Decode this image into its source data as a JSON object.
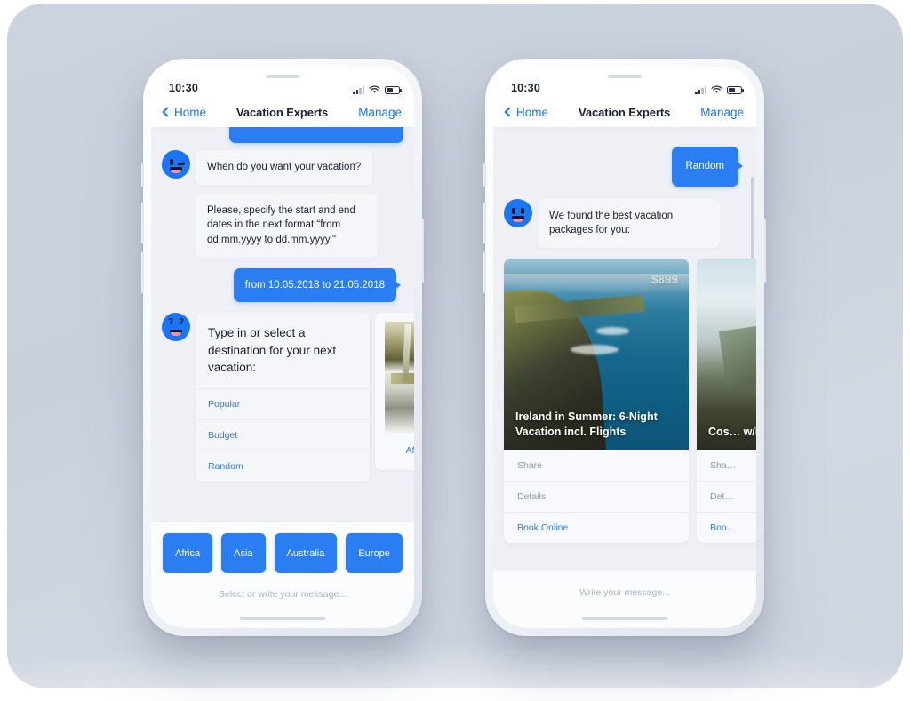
{
  "background": {
    "color": "#ccd3de"
  },
  "theme": {
    "accent": "#2a7ef2",
    "link": "#1775f0",
    "bubble_in_bg": "#f4f6fa",
    "text": "#1b2136",
    "muted": "#8e99ad"
  },
  "phones": [
    {
      "id": "left",
      "status_bar": {
        "time": "10:30",
        "signal_icon": "signal-bars-icon",
        "wifi_icon": "wifi-icon",
        "battery_icon": "battery-icon"
      },
      "nav": {
        "back_label": "Home",
        "back_icon": "chevron-left-icon",
        "title": "Vacation Experts",
        "action_label": "Manage"
      },
      "messages": [
        {
          "type": "outgoing-cutoff",
          "text": ""
        },
        {
          "type": "incoming",
          "avatar": "bot-wink-face",
          "text": "When do you want your vacation?"
        },
        {
          "type": "incoming",
          "avatar": "none",
          "text": "Please, specify the start and end dates in the next format “from dd.mm.yyyy to dd.mm.yyyy.\""
        },
        {
          "type": "outgoing",
          "text": "from 10.05.2018 to 21.05.2018"
        }
      ],
      "selector": {
        "avatar": "bot-question-face",
        "prompt": "Type in or select a destination for your next vacation:",
        "options": [
          "Popular",
          "Budget",
          "Random"
        ],
        "side_card_label": "Africa"
      },
      "quick_replies": [
        "Africa",
        "Asia",
        "Australia",
        "Europe"
      ],
      "composer": {
        "placeholder": "Select or write your message..."
      }
    },
    {
      "id": "right",
      "status_bar": {
        "time": "10:30",
        "signal_icon": "signal-bars-icon",
        "wifi_icon": "wifi-icon",
        "battery_icon": "battery-icon"
      },
      "nav": {
        "back_label": "Home",
        "back_icon": "chevron-left-icon",
        "title": "Vacation Experts",
        "action_label": "Manage"
      },
      "messages": [
        {
          "type": "outgoing",
          "text": "Random"
        },
        {
          "type": "incoming",
          "avatar": "bot-smile-face",
          "text": "We found the best vacation packages for you:"
        }
      ],
      "packages": [
        {
          "price": "$899",
          "title": "Ireland in Summer: 6-Night Vacation incl. Flights",
          "image": "ireland-coast-photo",
          "actions": [
            "Share",
            "Details",
            "Book Online"
          ]
        },
        {
          "price": "",
          "title": "Cos… w/F…",
          "image": "costa-rica-photo",
          "actions": [
            "Sha…",
            "Det…",
            "Boo…"
          ]
        }
      ],
      "composer": {
        "placeholder": "Write your message..."
      }
    }
  ]
}
